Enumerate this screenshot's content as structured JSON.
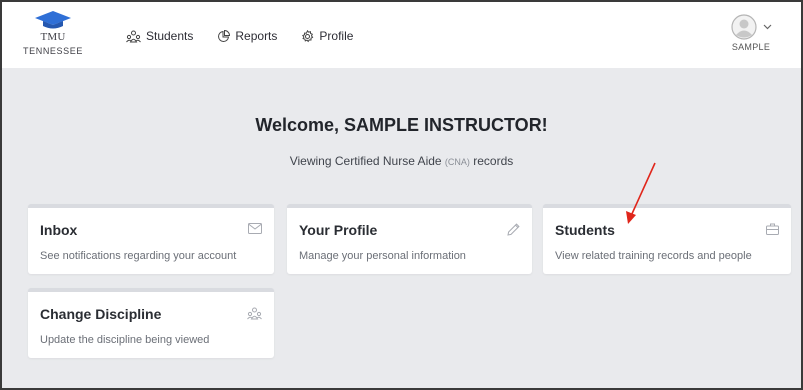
{
  "logo": {
    "abbr": "TMU",
    "state": "TENNESSEE"
  },
  "nav": {
    "students": "Students",
    "reports": "Reports",
    "profile": "Profile"
  },
  "user": {
    "name": "SAMPLE"
  },
  "welcome": "Welcome, SAMPLE INSTRUCTOR!",
  "subtitle": {
    "prefix": "Viewing Certified Nurse Aide",
    "abbr": "(CNA)",
    "suffix": "records"
  },
  "cards": [
    {
      "title": "Inbox",
      "desc": "See notifications regarding your account",
      "icon": "mail-icon"
    },
    {
      "title": "Your Profile",
      "desc": "Manage your personal information",
      "icon": "pencil-icon"
    },
    {
      "title": "Students",
      "desc": "View related training records and people",
      "icon": "briefcase-icon"
    },
    {
      "title": "Change Discipline",
      "desc": "Update the discipline being viewed",
      "icon": "people-icon"
    }
  ],
  "colors": {
    "background": "#e9eaed",
    "card": "#ffffff",
    "logo_blue": "#2f6fd6",
    "annotation_arrow": "#e0261b"
  }
}
